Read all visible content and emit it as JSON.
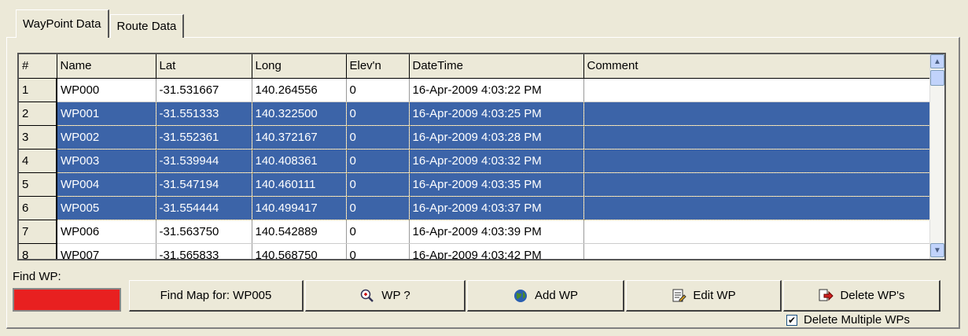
{
  "tabs": [
    {
      "label": "WayPoint Data"
    },
    {
      "label": "Route Data"
    }
  ],
  "grid": {
    "columns": [
      "#",
      "Name",
      "Lat",
      "Long",
      "Elev'n",
      "DateTime",
      "Comment"
    ],
    "rows": [
      {
        "num": "1",
        "name": "WP000",
        "lat": "-31.531667",
        "long": "140.264556",
        "elev": "0",
        "datetime": "16-Apr-2009 4:03:22 PM",
        "comment": "",
        "selected": false
      },
      {
        "num": "2",
        "name": "WP001",
        "lat": "-31.551333",
        "long": "140.322500",
        "elev": "0",
        "datetime": "16-Apr-2009 4:03:25 PM",
        "comment": "",
        "selected": true
      },
      {
        "num": "3",
        "name": "WP002",
        "lat": "-31.552361",
        "long": "140.372167",
        "elev": "0",
        "datetime": "16-Apr-2009 4:03:28 PM",
        "comment": "",
        "selected": true
      },
      {
        "num": "4",
        "name": "WP003",
        "lat": "-31.539944",
        "long": "140.408361",
        "elev": "0",
        "datetime": "16-Apr-2009 4:03:32 PM",
        "comment": "",
        "selected": true
      },
      {
        "num": "5",
        "name": "WP004",
        "lat": "-31.547194",
        "long": "140.460111",
        "elev": "0",
        "datetime": "16-Apr-2009 4:03:35 PM",
        "comment": "",
        "selected": true
      },
      {
        "num": "6",
        "name": "WP005",
        "lat": "-31.554444",
        "long": "140.499417",
        "elev": "0",
        "datetime": "16-Apr-2009 4:03:37 PM",
        "comment": "",
        "selected": true
      },
      {
        "num": "7",
        "name": "WP006",
        "lat": "-31.563750",
        "long": "140.542889",
        "elev": "0",
        "datetime": "16-Apr-2009 4:03:39 PM",
        "comment": "",
        "selected": false
      },
      {
        "num": "8",
        "name": "WP007",
        "lat": "-31.565833",
        "long": "140.568750",
        "elev": "0",
        "datetime": "16-Apr-2009 4:03:42 PM",
        "comment": "",
        "selected": false
      }
    ]
  },
  "find": {
    "label": "Find WP:",
    "box_color": "#e82020"
  },
  "buttons": {
    "find_map": "Find Map for: WP005",
    "wp_query": "WP ?",
    "add_wp": "Add WP",
    "edit_wp": "Edit WP",
    "delete_wps": "Delete WP's"
  },
  "delete_multiple": {
    "label": "Delete Multiple WPs",
    "checked": true
  },
  "colors": {
    "selection": "#3c64a8",
    "window_bg": "#ece9d8"
  }
}
